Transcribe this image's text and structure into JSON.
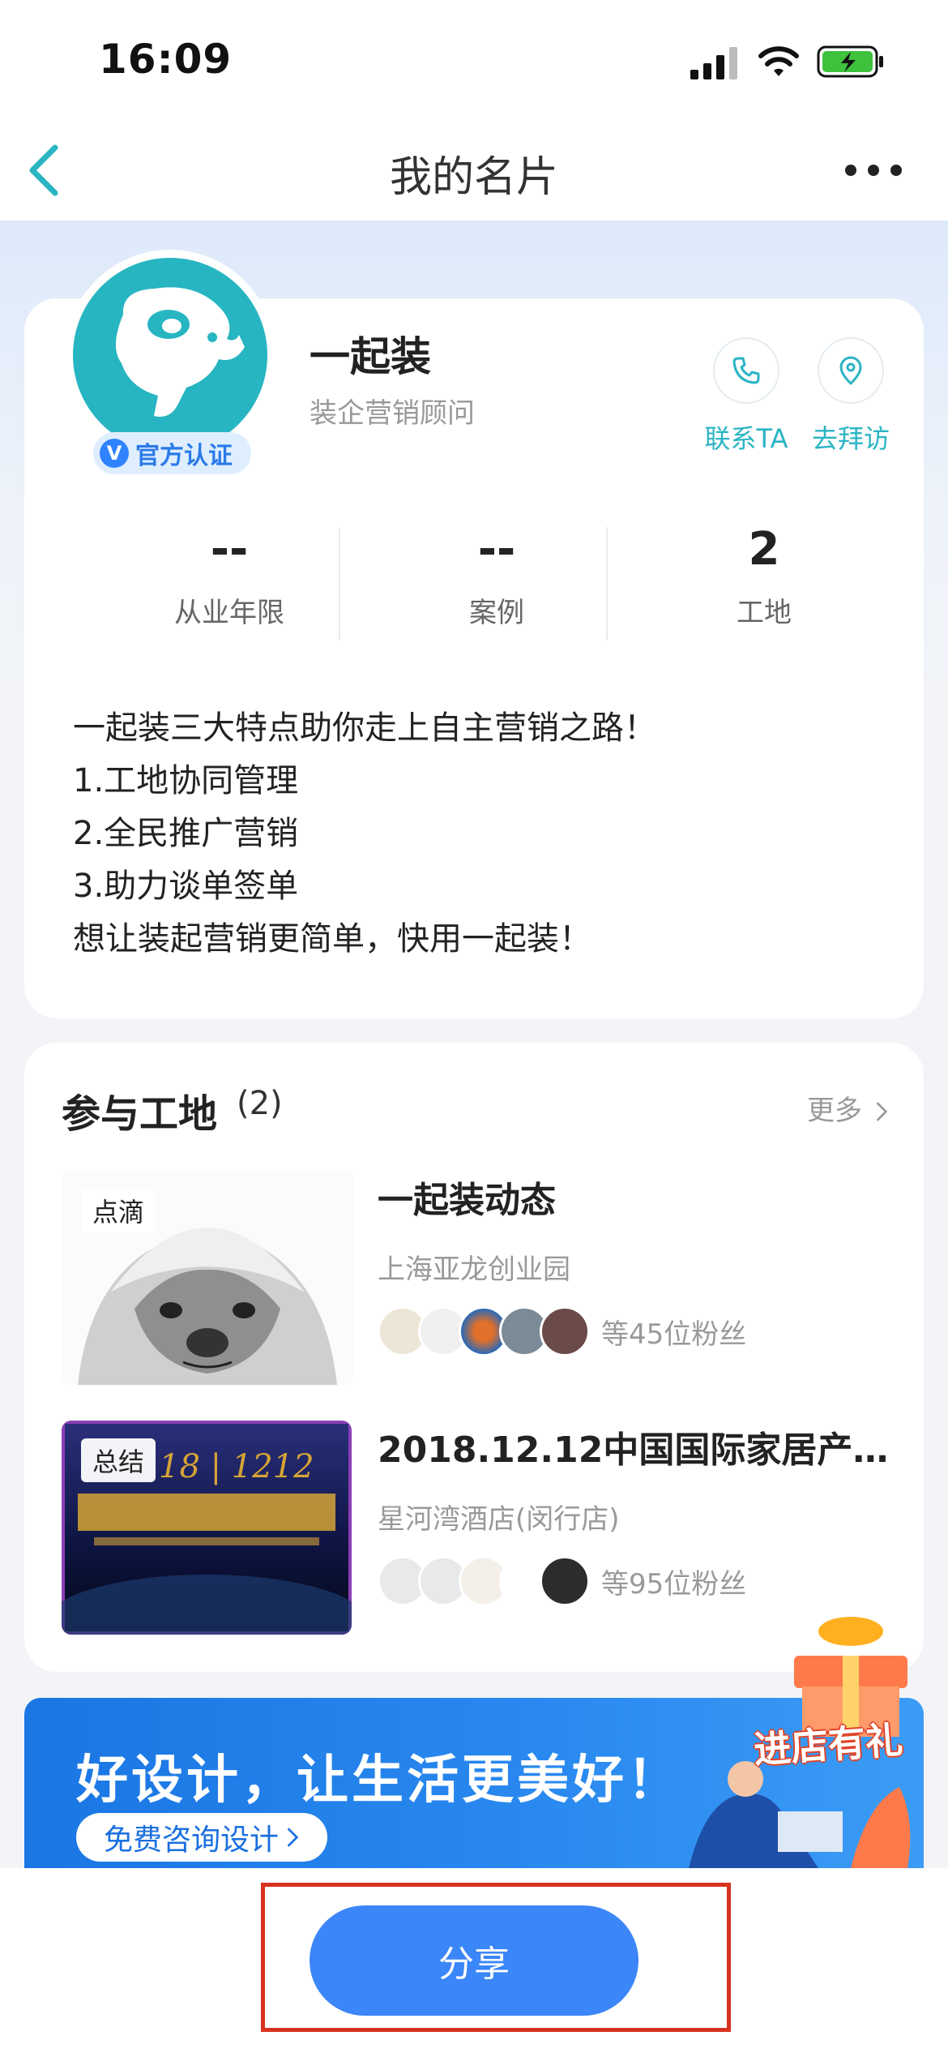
{
  "status_bar": {
    "time": "16:09"
  },
  "nav": {
    "title": "我的名片"
  },
  "profile": {
    "badge": "官方认证",
    "name": "一起装",
    "role": "装企营销顾问",
    "actions": [
      {
        "label": "联系TA",
        "icon": "phone-icon"
      },
      {
        "label": "去拜访",
        "icon": "location-icon"
      }
    ],
    "stats": [
      {
        "value": "--",
        "label": "从业年限"
      },
      {
        "value": "--",
        "label": "案例"
      },
      {
        "value": "2",
        "label": "工地"
      }
    ],
    "intro": [
      "一起装三大特点助你走上自主营销之路！",
      "1.工地协同管理",
      "2.全民推广营销",
      "3.助力谈单签单",
      "想让装起营销更简单，快用一起装！"
    ]
  },
  "sites": {
    "title": "参与工地",
    "count": "(2)",
    "more": "更多",
    "items": [
      {
        "tag": "点滴",
        "title": "一起装动态",
        "address": "上海亚龙创业园",
        "fans": "等45位粉丝"
      },
      {
        "tag": "总结",
        "title": "2018.12.12中国国际家居产…",
        "address": "星河湾酒店(闵行店)",
        "fans": "等95位粉丝"
      }
    ]
  },
  "banner": {
    "title": "好设计，让生活更美好！",
    "button": "免费咨询设计",
    "gift": "进店有礼"
  },
  "bottom": {
    "share": "分享"
  },
  "colors": {
    "accent": "#2ab4c4",
    "primary": "#3b86f8",
    "highlight": "#d8321f"
  }
}
